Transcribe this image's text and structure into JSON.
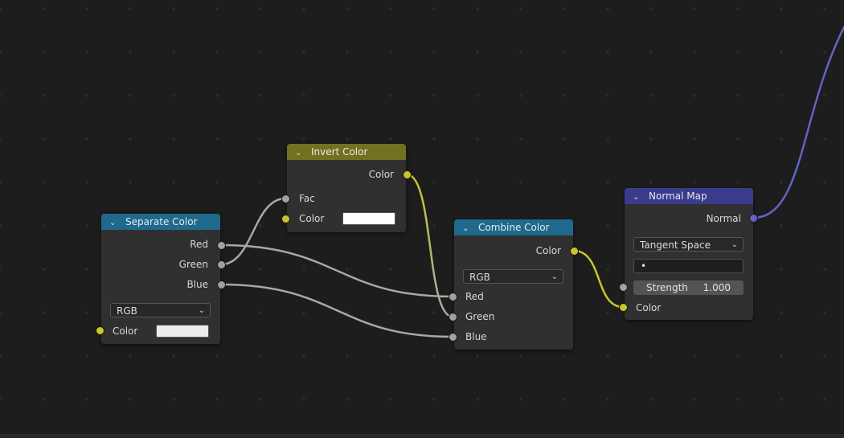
{
  "nodes": {
    "separate_color": {
      "title": "Separate Color",
      "header_color": "#1f6a8c",
      "outputs": [
        "Red",
        "Green",
        "Blue"
      ],
      "mode": "RGB",
      "input_label": "Color",
      "input_swatch": "#ececec"
    },
    "invert_color": {
      "title": "Invert Color",
      "header_color": "#71711f",
      "output_label": "Color",
      "fac_label": "Fac",
      "color_label": "Color",
      "color_swatch": "#ffffff"
    },
    "combine_color": {
      "title": "Combine Color",
      "header_color": "#1f6a8c",
      "output_label": "Color",
      "mode": "RGB",
      "inputs": [
        "Red",
        "Green",
        "Blue"
      ]
    },
    "normal_map": {
      "title": "Normal Map",
      "header_color": "#3b3b8e",
      "output_label": "Normal",
      "space": "Tangent Space",
      "uv_field": "•",
      "strength_label": "Strength",
      "strength_value": "1.000",
      "input_label": "Color"
    }
  },
  "colors": {
    "socket_color": "#c7c729",
    "socket_float": "#a1a1a1",
    "socket_vector": "#6363c7",
    "background": "#1d1d1d",
    "node_body": "#303030"
  }
}
